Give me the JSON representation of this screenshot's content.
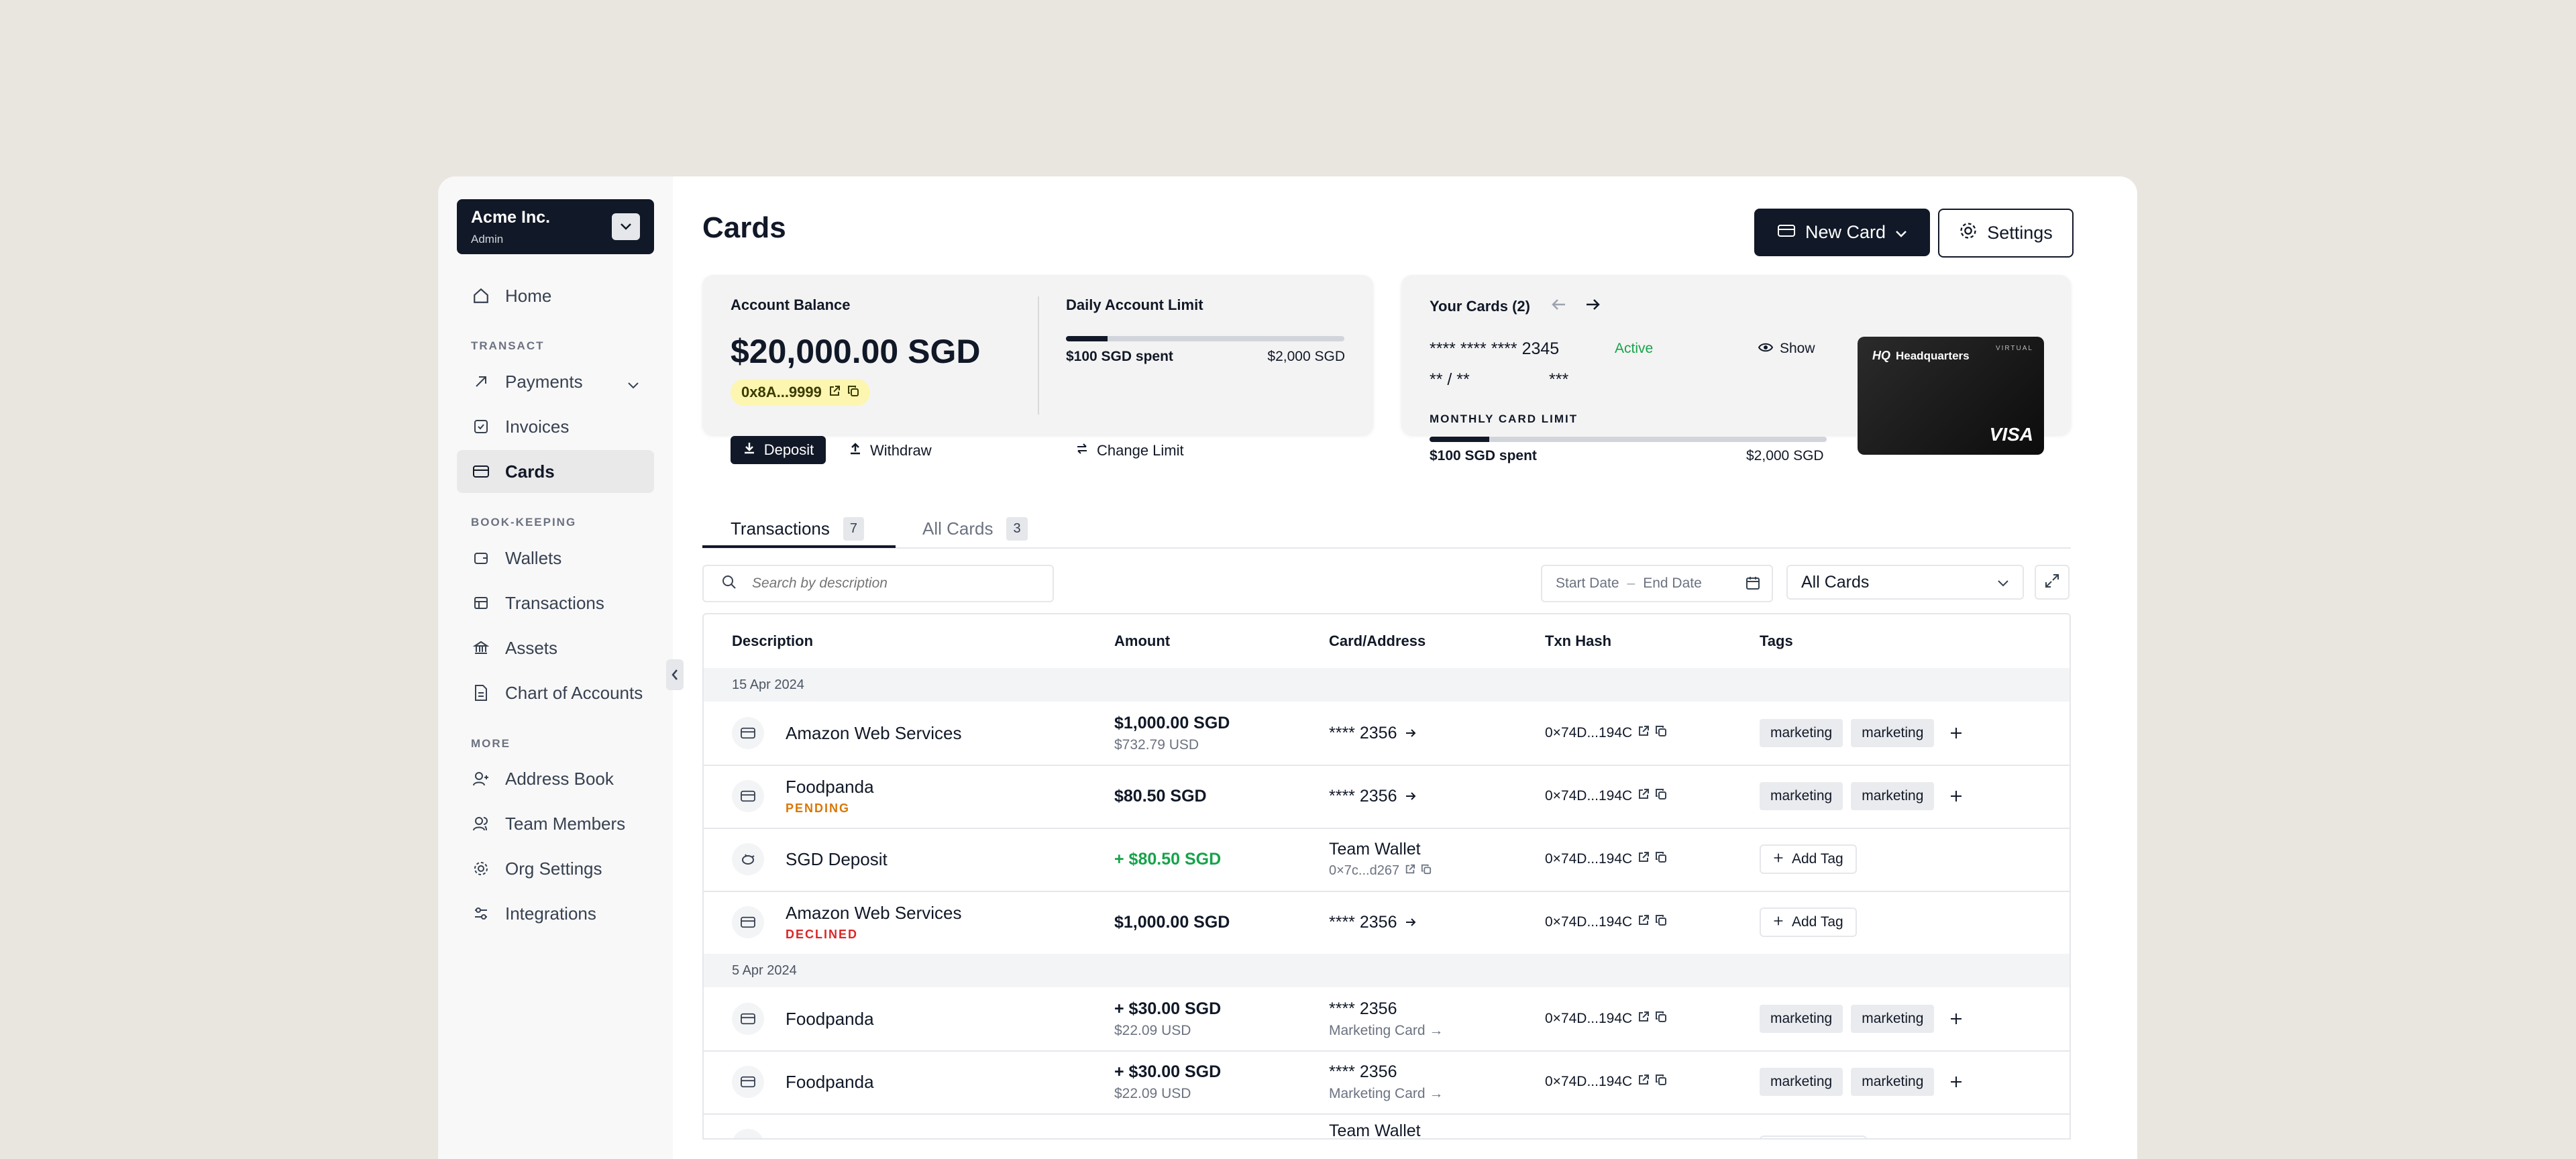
{
  "org": {
    "name": "Acme Inc.",
    "role": "Admin"
  },
  "sidebar": {
    "home": "Home",
    "section_transact": "TRANSACT",
    "payments": "Payments",
    "invoices": "Invoices",
    "cards": "Cards",
    "section_bookkeeping": "BOOK-KEEPING",
    "wallets": "Wallets",
    "transactions": "Transactions",
    "assets": "Assets",
    "chart_of_accounts": "Chart of Accounts",
    "section_more": "MORE",
    "address_book": "Address Book",
    "team_members": "Team Members",
    "org_settings": "Org Settings",
    "integrations": "Integrations"
  },
  "header": {
    "title": "Cards",
    "new_card": "New Card",
    "settings": "Settings"
  },
  "account": {
    "balance_label": "Account Balance",
    "balance": "$20,000.00 SGD",
    "address": "0x8A...9999",
    "deposit": "Deposit",
    "withdraw": "Withdraw",
    "limit_label": "Daily Account Limit",
    "spent": "$100 SGD spent",
    "limit": "$2,000 SGD",
    "limit_progress": 0.15,
    "change_limit": "Change Limit"
  },
  "your_cards": {
    "label": "Your Cards (2)",
    "number": "**** **** **** 2345",
    "status": "Active",
    "show": "Show",
    "expiry": "** / **",
    "cvv": "***",
    "monthly_label": "MONTHLY CARD LIMIT",
    "spent": "$100 SGD spent",
    "limit": "$2,000 SGD",
    "limit_progress": 0.15,
    "card_brand": "Headquarters",
    "card_type": "VIRTUAL",
    "network": "VISA"
  },
  "tabs": [
    {
      "label": "Transactions",
      "count": "7"
    },
    {
      "label": "All Cards",
      "count": "3"
    }
  ],
  "filters": {
    "search_placeholder": "Search by description",
    "start_date": "Start Date",
    "date_sep": "–",
    "end_date": "End Date",
    "cards_select": "All Cards"
  },
  "table": {
    "columns": [
      "Description",
      "Amount",
      "Card/Address",
      "Txn Hash",
      "Tags"
    ],
    "groups": [
      "15 Apr 2024",
      "5 Apr 2024"
    ],
    "rows": [
      {
        "desc": "Amazon Web Services",
        "status": "",
        "amount": "$1,000.00 SGD",
        "sub": "$732.79 USD",
        "card": "**** 2356",
        "card_sub": "",
        "hash": "0×74D...194C",
        "tag1": "marketing",
        "tag2": "marketing"
      },
      {
        "desc": "Foodpanda",
        "status": "PENDING",
        "amount": "$80.50 SGD",
        "sub": "",
        "card": "**** 2356",
        "card_sub": "",
        "hash": "0×74D...194C",
        "tag1": "marketing",
        "tag2": "marketing"
      },
      {
        "desc": "SGD Deposit",
        "status": "",
        "amount": "+ $80.50 SGD",
        "sub": "",
        "card": "Team Wallet",
        "card_sub": "0×7c...d267",
        "hash": "0×74D...194C",
        "add_tag": "Add Tag"
      },
      {
        "desc": "Amazon Web Services",
        "status": "DECLINED",
        "amount": "$1,000.00 SGD",
        "sub": "",
        "card": "**** 2356",
        "card_sub": "",
        "hash": "0×74D...194C",
        "add_tag": "Add Tag"
      },
      {
        "desc": "Foodpanda",
        "status": "",
        "amount": "+ $30.00 SGD",
        "sub": "$22.09 USD",
        "card": "**** 2356",
        "card_sub": "Marketing Card →",
        "hash": "0×74D...194C",
        "tag1": "marketing",
        "tag2": "marketing"
      },
      {
        "desc": "Foodpanda",
        "status": "",
        "amount": "+ $30.00 SGD",
        "sub": "$22.09 USD",
        "card": "**** 2356",
        "card_sub": "Marketing Card →",
        "hash": "0×74D...194C",
        "tag1": "marketing",
        "tag2": "marketing"
      },
      {
        "card": "Team Wallet"
      }
    ]
  },
  "colors": {
    "pending": "#d97706",
    "declined": "#dc2626",
    "active": "#16a34a",
    "deposit_amount": "#16a34a",
    "accent": "#111827"
  }
}
